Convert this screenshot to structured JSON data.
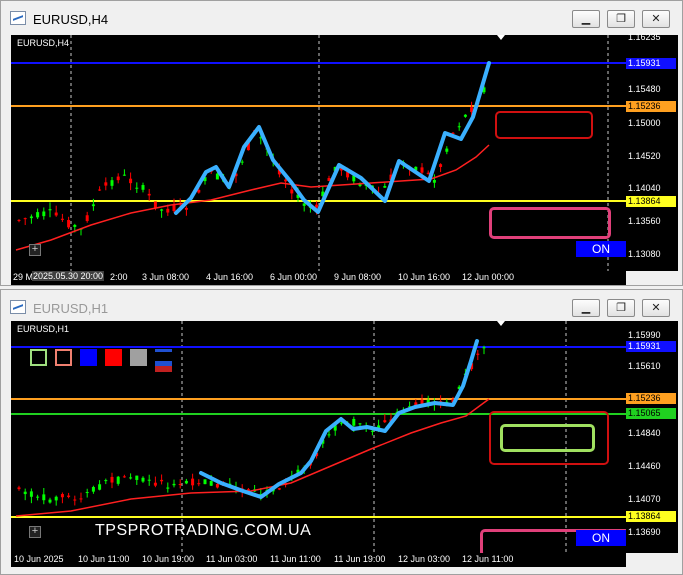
{
  "window1": {
    "title": "EURUSD,H4",
    "symbol_label": "EURUSD,H4",
    "price_labels": [
      "1.16235",
      "1.15480",
      "1.15000",
      "1.14520",
      "1.14040",
      "1.13560",
      "1.13080"
    ],
    "tags": {
      "blue": "1.15931",
      "orange": "1.15236",
      "yellow": "1.13864"
    },
    "time_labels": [
      "29 M",
      "2025.05.30 20:00",
      "2:00",
      "3 Jun 08:00",
      "4 Jun 16:00",
      "6 Jun 00:00",
      "9 Jun 08:00",
      "10 Jun 16:00",
      "12 Jun 00:00"
    ],
    "on_button": "ON",
    "colors": {
      "bull": "#00ff00",
      "bear": "#ff0000",
      "ma": "#ff2020",
      "wave": "#3ab0ff",
      "blue_line": "#1010ff",
      "orange_line": "#ffa020",
      "yellow_line": "#ffff20"
    }
  },
  "window2": {
    "title": "EURUSD,H1",
    "symbol_label": "EURUSD,H1",
    "price_labels": [
      "1.15990",
      "1.15610",
      "1.14840",
      "1.14460",
      "1.14070",
      "1.13690"
    ],
    "tags": {
      "blue": "1.15931",
      "orange": "1.15236",
      "green": "1.15065",
      "yellow": "1.13864"
    },
    "time_labels": [
      "10 Jun 2025",
      "10 Jun 11:00",
      "10 Jun 19:00",
      "11 Jun 03:00",
      "11 Jun 11:00",
      "11 Jun 19:00",
      "12 Jun 03:00",
      "12 Jun 11:00"
    ],
    "on_button": "ON",
    "watermark": "TPSPROTRADING.COM.UA",
    "toolbar": [
      {
        "name": "green-square-tool",
        "color": "#a0e080"
      },
      {
        "name": "salmon-square-tool",
        "color": "#f08070"
      },
      {
        "name": "blue-fill-tool",
        "color": "#0000ff"
      },
      {
        "name": "red-fill-tool",
        "color": "#ff0000"
      },
      {
        "name": "gray-fill-tool",
        "color": "#a0a0a0"
      },
      {
        "name": "lines-tool",
        "color": "#2050d0"
      }
    ]
  },
  "titlebar_buttons": {
    "minimize": "▁",
    "restore": "❐",
    "close": "✕"
  }
}
